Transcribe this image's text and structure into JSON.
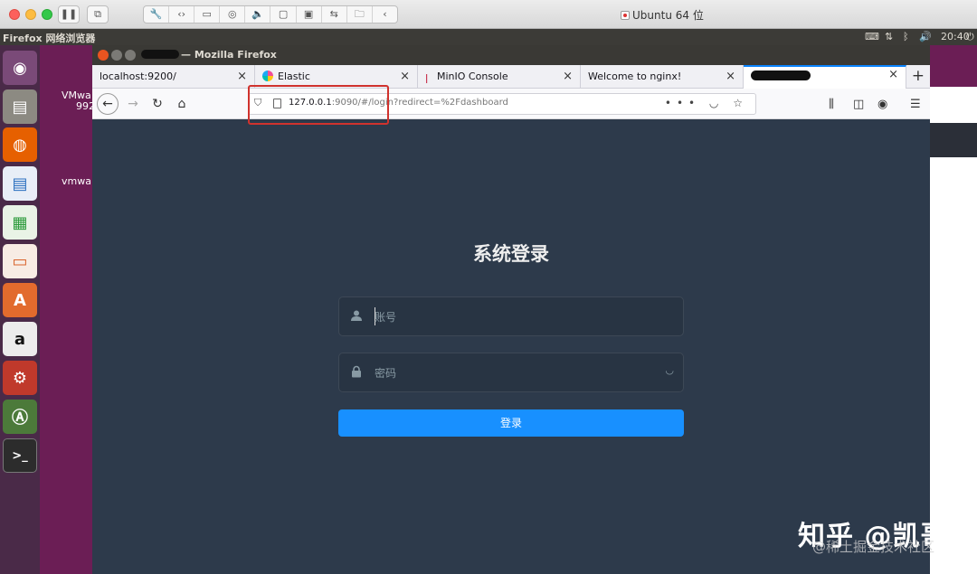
{
  "mac_host": {
    "window_title": "Ubuntu 64 位",
    "toolbar_icons": [
      "pause-icon",
      "snapshot-icon",
      "wrench-icon",
      "code-icon",
      "drive-icon",
      "camera-icon",
      "speaker-icon",
      "video-icon",
      "display-icon",
      "usb-icon",
      "shared-folder-icon",
      "chevron-left-icon"
    ]
  },
  "ubuntu_panel": {
    "app_name": "Firefox 网络浏览器",
    "time": "20:40"
  },
  "desktop": {
    "labels": [
      "VMwa",
      "992",
      "vmwar"
    ]
  },
  "firefox": {
    "window_title": "— Mozilla Firefox",
    "tabs": [
      {
        "label": "localhost:9200/",
        "active": false
      },
      {
        "label": "Elastic",
        "active": false
      },
      {
        "label": "MinIO Console",
        "active": false
      },
      {
        "label": "Welcome to nginx!",
        "active": false
      },
      {
        "label": "",
        "active": true
      }
    ],
    "close_glyph": "×",
    "new_tab_glyph": "+",
    "url": {
      "host": "127.0.0.1",
      "rest": ":9090/#/login?redirect=%2Fdashboard"
    }
  },
  "login": {
    "title": "系统登录",
    "username_placeholder": "账号",
    "password_placeholder": "密码",
    "submit_label": "登录"
  },
  "watermark": {
    "main": "知乎 @凯哥",
    "sub": "@稀土掘金技术社区"
  },
  "colors": {
    "page_bg": "#2d3a4b",
    "field_bg": "#283443",
    "button": "#1890ff",
    "highlight": "#d0322d"
  }
}
